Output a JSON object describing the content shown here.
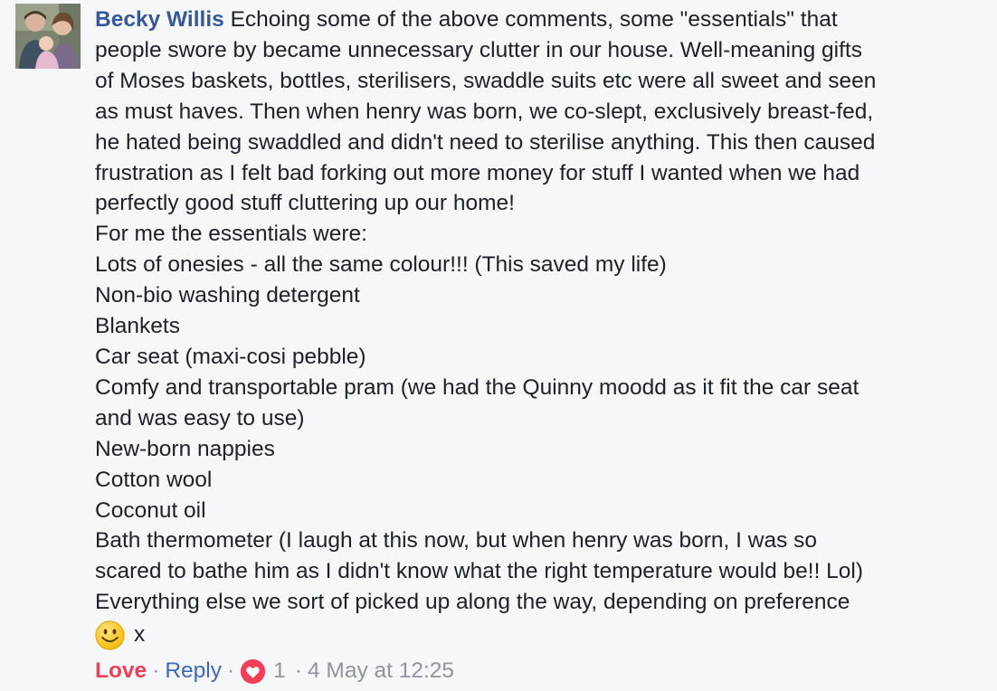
{
  "comment": {
    "author": "Becky Willis",
    "paragraph": [
      "Echoing some of the above comments, some \"essentials\" that",
      "people swore by became unnecessary clutter in our house. Well-meaning gifts",
      "of Moses baskets, bottles, sterilisers, swaddle suits etc were all sweet and seen",
      "as must haves. Then when henry was born, we co-slept, exclusively breast-fed,",
      "he hated being swaddled and didn't need to sterilise anything. This then caused",
      "frustration as I felt bad forking out more money for stuff I wanted when we had",
      "perfectly good stuff cluttering up our home!"
    ],
    "intro": "For me the essentials were:",
    "items": [
      "Lots of onesies - all the same colour!!! (This saved my life)",
      "Non-bio washing detergent",
      "Blankets",
      "Car seat (maxi-cosi pebble)",
      "Comfy and transportable pram (we had the Quinny moodd as it fit the car seat",
      "and was easy to use)",
      "New-born nappies",
      "Cotton wool",
      "Coconut oil",
      "Bath thermometer (I laugh at this now, but when henry was born, I was so",
      "scared to bathe him as I didn't know what the right temperature would be!! Lol)",
      "Everything else we sort of picked up along the way, depending on preference"
    ],
    "emoji": "smiley-face-icon",
    "sign_off": "x"
  },
  "actions": {
    "love_label": "Love",
    "separator": "·",
    "reply_label": "Reply",
    "reaction_icon": "heart-icon",
    "reaction_count": "1",
    "timestamp": "4 May at 12:25"
  },
  "colors": {
    "background": "#f6f7f9",
    "author": "#365899",
    "love": "#f33e58",
    "reply": "#4267b2",
    "meta": "#90949c",
    "text": "#1d2129"
  }
}
